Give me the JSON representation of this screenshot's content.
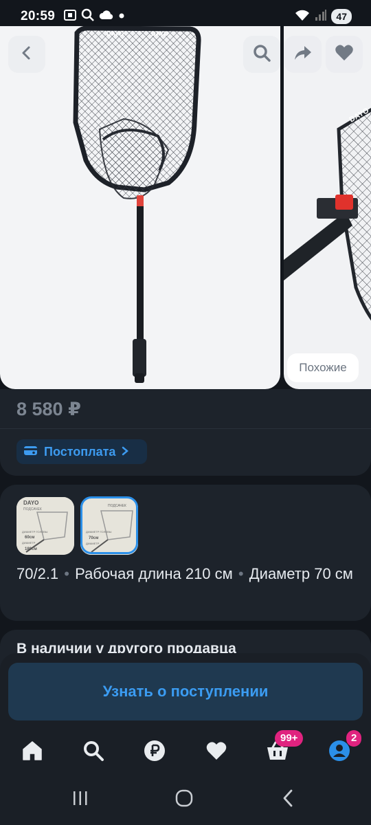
{
  "status_bar": {
    "time": "20:59",
    "battery": "47"
  },
  "gallery": {
    "similar_label": "Похожие",
    "brand_text": "DAYO"
  },
  "price_section": {
    "price": "8 580 ₽",
    "postpay_label": "Постоплата"
  },
  "variants": {
    "thumb_1_lines": [
      "DAYO",
      "ПОДСАЧЕК",
      "ДИАМЕТР ГОЛОВЫ",
      "60см",
      "ДИАМЕТР",
      "180см"
    ],
    "thumb_2_lines": [
      "ПОДСАЧЕК",
      "ДИАМЕТР ГОЛОВЫ",
      "70см",
      "ДИАМЕТР"
    ],
    "spec_model": "70/2.1",
    "spec_length": "Рабочая длина 210 см",
    "spec_diameter": "Диаметр 70 см",
    "separator": "•"
  },
  "availability": {
    "title": "В наличии у другого продавца"
  },
  "bottom": {
    "notify_label": "Узнать о поступлении",
    "cart_badge": "99+",
    "profile_badge": "2"
  },
  "colors": {
    "background": "#12161c",
    "card": "#1d232b",
    "accent": "#3b9cf2",
    "badge": "#e0237f"
  }
}
